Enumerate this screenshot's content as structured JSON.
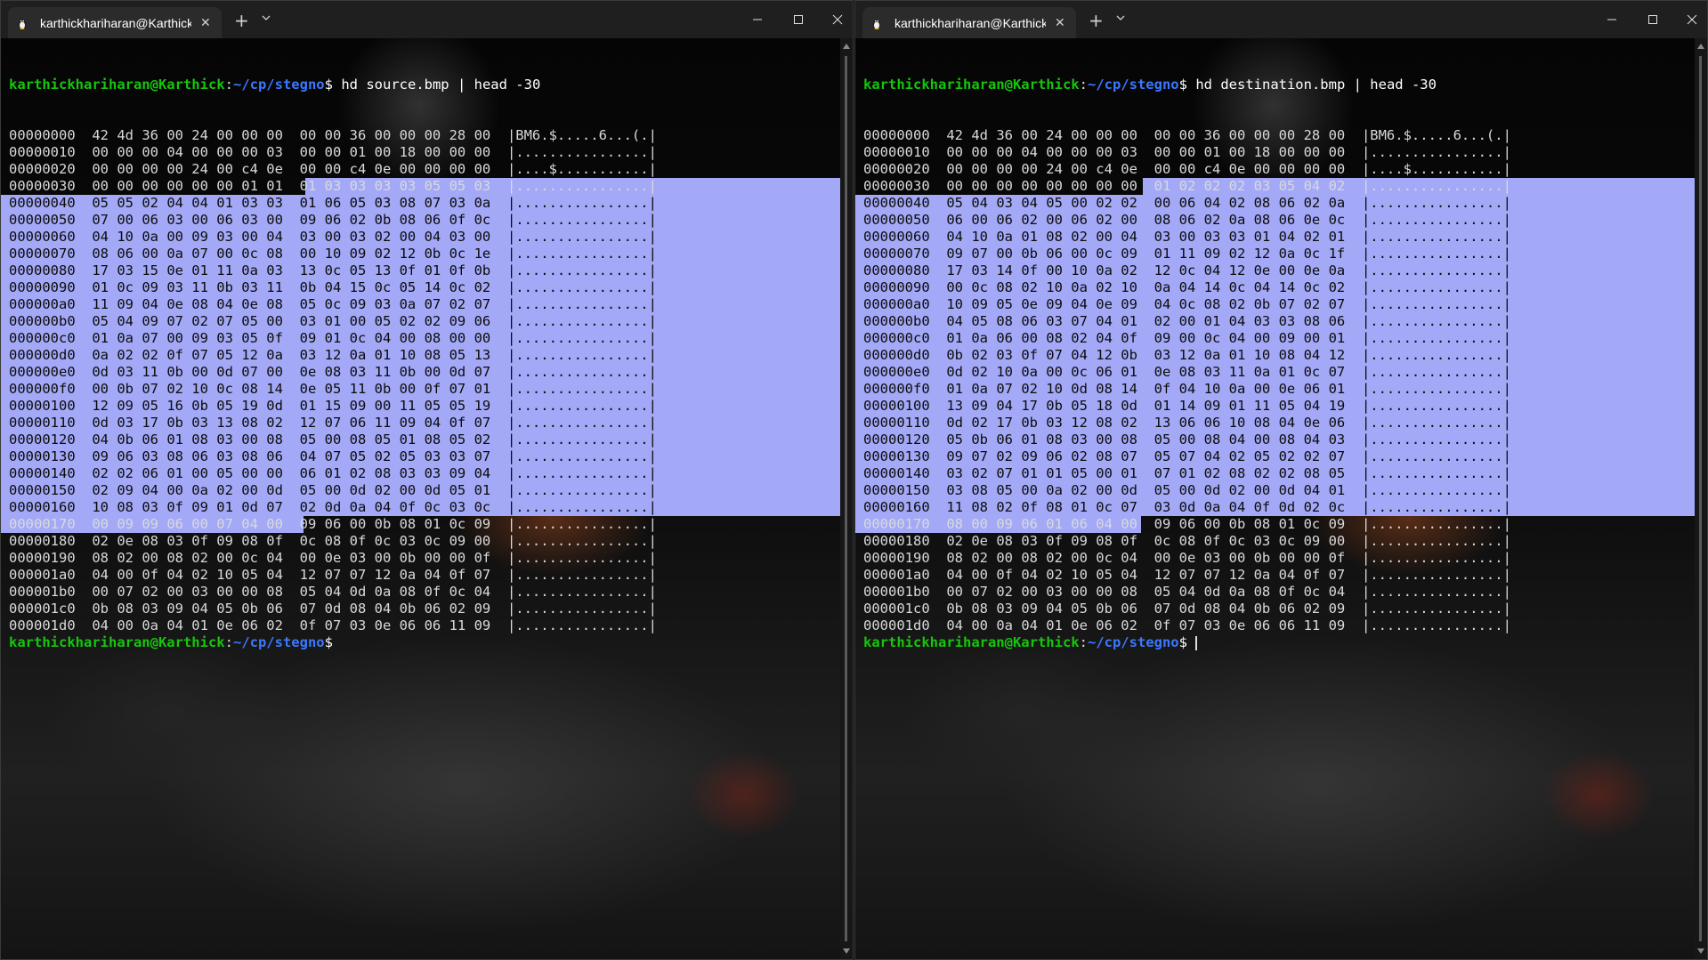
{
  "windows": [
    {
      "tab_title": "karthickhariharan@Karthick",
      "prompt_user": "karthickhariharan@Karthick",
      "prompt_path": "~/cp/stegno",
      "command": "hd source.bmp | head -30",
      "rows": [
        {
          "addr": "00000000",
          "hex": "42 4d 36 00 24 00 00 00  00 00 36 00 00 00 28 00",
          "ascii": "|BM6.$.....6...(.|"
        },
        {
          "addr": "00000010",
          "hex": "00 00 00 04 00 00 00 03  00 00 01 00 18 00 00 00",
          "ascii": "|................|"
        },
        {
          "addr": "00000020",
          "hex": "00 00 00 00 24 00 c4 0e  00 00 c4 0e 00 00 00 00",
          "ascii": "|....$...........|"
        },
        {
          "addr": "00000030",
          "hex": "00 00 00 00 00 00 01 01  01 03 03 03 03 05 05 03",
          "ascii": "|................|"
        },
        {
          "addr": "00000040",
          "hex": "05 05 02 04 04 01 03 03  01 06 05 03 08 07 03 0a",
          "ascii": "|................|"
        },
        {
          "addr": "00000050",
          "hex": "07 00 06 03 00 06 03 00  09 06 02 0b 08 06 0f 0c",
          "ascii": "|................|"
        },
        {
          "addr": "00000060",
          "hex": "04 10 0a 00 09 03 00 04  03 00 03 02 00 04 03 00",
          "ascii": "|................|"
        },
        {
          "addr": "00000070",
          "hex": "08 06 00 0a 07 00 0c 08  00 10 09 02 12 0b 0c 1e",
          "ascii": "|................|"
        },
        {
          "addr": "00000080",
          "hex": "17 03 15 0e 01 11 0a 03  13 0c 05 13 0f 01 0f 0b",
          "ascii": "|................|"
        },
        {
          "addr": "00000090",
          "hex": "01 0c 09 03 11 0b 03 11  0b 04 15 0c 05 14 0c 02",
          "ascii": "|................|"
        },
        {
          "addr": "000000a0",
          "hex": "11 09 04 0e 08 04 0e 08  05 0c 09 03 0a 07 02 07",
          "ascii": "|................|"
        },
        {
          "addr": "000000b0",
          "hex": "05 04 09 07 02 07 05 00  03 01 00 05 02 02 09 06",
          "ascii": "|................|"
        },
        {
          "addr": "000000c0",
          "hex": "01 0a 07 00 09 03 05 0f  09 01 0c 04 00 08 00 00",
          "ascii": "|................|"
        },
        {
          "addr": "000000d0",
          "hex": "0a 02 02 0f 07 05 12 0a  03 12 0a 01 10 08 05 13",
          "ascii": "|................|"
        },
        {
          "addr": "000000e0",
          "hex": "0d 03 11 0b 00 0d 07 00  0e 08 03 11 0b 00 0d 07",
          "ascii": "|................|"
        },
        {
          "addr": "000000f0",
          "hex": "00 0b 07 02 10 0c 08 14  0e 05 11 0b 00 0f 07 01",
          "ascii": "|................|"
        },
        {
          "addr": "00000100",
          "hex": "12 09 05 16 0b 05 19 0d  01 15 09 00 11 05 05 19",
          "ascii": "|................|"
        },
        {
          "addr": "00000110",
          "hex": "0d 03 17 0b 03 13 08 02  12 07 06 11 09 04 0f 07",
          "ascii": "|................|"
        },
        {
          "addr": "00000120",
          "hex": "04 0b 06 01 08 03 00 08  05 00 08 05 01 08 05 02",
          "ascii": "|................|"
        },
        {
          "addr": "00000130",
          "hex": "09 06 03 08 06 03 08 06  04 07 05 02 05 03 03 07",
          "ascii": "|................|"
        },
        {
          "addr": "00000140",
          "hex": "02 02 06 01 00 05 00 00  06 01 02 08 03 03 09 04",
          "ascii": "|................|"
        },
        {
          "addr": "00000150",
          "hex": "02 09 04 00 0a 02 00 0d  05 00 0d 02 00 0d 05 01",
          "ascii": "|................|"
        },
        {
          "addr": "00000160",
          "hex": "10 08 03 0f 09 01 0d 07  02 0d 0a 04 0f 0c 03 0c",
          "ascii": "|................|"
        },
        {
          "addr": "00000170",
          "hex": "00 09 09 06 00 07 04 00  09 06 00 0b 08 01 0c 09",
          "ascii": "|................|"
        },
        {
          "addr": "00000180",
          "hex": "02 0e 08 03 0f 09 08 0f  0c 08 0f 0c 03 0c 09 00",
          "ascii": "|................|"
        },
        {
          "addr": "00000190",
          "hex": "08 02 00 08 02 00 0c 04  00 0e 03 00 0b 00 00 0f",
          "ascii": "|................|"
        },
        {
          "addr": "000001a0",
          "hex": "04 00 0f 04 02 10 05 04  12 07 07 12 0a 04 0f 07",
          "ascii": "|................|"
        },
        {
          "addr": "000001b0",
          "hex": "00 07 02 00 03 00 00 08  05 04 0d 0a 08 0f 0c 04",
          "ascii": "|................|"
        },
        {
          "addr": "000001c0",
          "hex": "0b 08 03 09 04 05 0b 06  07 0d 08 04 0b 06 02 09",
          "ascii": "|................|"
        },
        {
          "addr": "000001d0",
          "hex": "04 00 0a 04 01 0e 06 02  0f 07 03 0e 06 06 11 09",
          "ascii": "|................|"
        }
      ]
    },
    {
      "tab_title": "karthickhariharan@Karthick",
      "prompt_user": "karthickhariharan@Karthick",
      "prompt_path": "~/cp/stegno",
      "command": "hd destination.bmp | head -30",
      "rows": [
        {
          "addr": "00000000",
          "hex": "42 4d 36 00 24 00 00 00  00 00 36 00 00 00 28 00",
          "ascii": "|BM6.$.....6...(.|"
        },
        {
          "addr": "00000010",
          "hex": "00 00 00 04 00 00 00 03  00 00 01 00 18 00 00 00",
          "ascii": "|................|"
        },
        {
          "addr": "00000020",
          "hex": "00 00 00 00 24 00 c4 0e  00 00 c4 0e 00 00 00 00",
          "ascii": "|....$...........|"
        },
        {
          "addr": "00000030",
          "hex": "00 00 00 00 00 00 00 00  01 02 02 02 03 05 04 02",
          "ascii": "|................|"
        },
        {
          "addr": "00000040",
          "hex": "05 04 03 04 05 00 02 02  00 06 04 02 08 06 02 0a",
          "ascii": "|................|"
        },
        {
          "addr": "00000050",
          "hex": "06 00 06 02 00 06 02 00  08 06 02 0a 08 06 0e 0c",
          "ascii": "|................|"
        },
        {
          "addr": "00000060",
          "hex": "04 10 0a 01 08 02 00 04  03 00 03 03 01 04 02 01",
          "ascii": "|................|"
        },
        {
          "addr": "00000070",
          "hex": "09 07 00 0b 06 00 0c 09  01 11 09 02 12 0a 0c 1f",
          "ascii": "|................|"
        },
        {
          "addr": "00000080",
          "hex": "17 03 14 0f 00 10 0a 02  12 0c 04 12 0e 00 0e 0a",
          "ascii": "|................|"
        },
        {
          "addr": "00000090",
          "hex": "00 0c 08 02 10 0a 02 10  0a 04 14 0c 04 14 0c 02",
          "ascii": "|................|"
        },
        {
          "addr": "000000a0",
          "hex": "10 09 05 0e 09 04 0e 09  04 0c 08 02 0b 07 02 07",
          "ascii": "|................|"
        },
        {
          "addr": "000000b0",
          "hex": "04 05 08 06 03 07 04 01  02 00 01 04 03 03 08 06",
          "ascii": "|................|"
        },
        {
          "addr": "000000c0",
          "hex": "01 0a 06 00 08 02 04 0f  09 00 0c 04 00 09 00 01",
          "ascii": "|................|"
        },
        {
          "addr": "000000d0",
          "hex": "0b 02 03 0f 07 04 12 0b  03 12 0a 01 10 08 04 12",
          "ascii": "|................|"
        },
        {
          "addr": "000000e0",
          "hex": "0d 02 10 0a 00 0c 06 01  0e 08 03 11 0a 01 0c 07",
          "ascii": "|................|"
        },
        {
          "addr": "000000f0",
          "hex": "01 0a 07 02 10 0d 08 14  0f 04 10 0a 00 0e 06 01",
          "ascii": "|................|"
        },
        {
          "addr": "00000100",
          "hex": "13 09 04 17 0b 05 18 0d  01 14 09 01 11 05 04 19",
          "ascii": "|................|"
        },
        {
          "addr": "00000110",
          "hex": "0d 02 17 0b 03 12 08 02  13 06 06 10 08 04 0e 06",
          "ascii": "|................|"
        },
        {
          "addr": "00000120",
          "hex": "05 0b 06 01 08 03 00 08  05 00 08 04 00 08 04 03",
          "ascii": "|................|"
        },
        {
          "addr": "00000130",
          "hex": "09 07 02 09 06 02 08 07  05 07 04 02 05 02 02 07",
          "ascii": "|................|"
        },
        {
          "addr": "00000140",
          "hex": "03 02 07 01 01 05 00 01  07 01 02 08 02 02 08 05",
          "ascii": "|................|"
        },
        {
          "addr": "00000150",
          "hex": "03 08 05 00 0a 02 00 0d  05 00 0d 02 00 0d 04 01",
          "ascii": "|................|"
        },
        {
          "addr": "00000160",
          "hex": "11 08 02 0f 08 01 0c 07  03 0d 0a 04 0f 0d 02 0c",
          "ascii": "|................|"
        },
        {
          "addr": "00000170",
          "hex": "08 00 09 06 01 06 04 00  09 06 00 0b 08 01 0c 09",
          "ascii": "|................|"
        },
        {
          "addr": "00000180",
          "hex": "02 0e 08 03 0f 09 08 0f  0c 08 0f 0c 03 0c 09 00",
          "ascii": "|................|"
        },
        {
          "addr": "00000190",
          "hex": "08 02 00 08 02 00 0c 04  00 0e 03 00 0b 00 00 0f",
          "ascii": "|................|"
        },
        {
          "addr": "000001a0",
          "hex": "04 00 0f 04 02 10 05 04  12 07 07 12 0a 04 0f 07",
          "ascii": "|................|"
        },
        {
          "addr": "000001b0",
          "hex": "00 07 02 00 03 00 00 08  05 04 0d 0a 08 0f 0c 04",
          "ascii": "|................|"
        },
        {
          "addr": "000001c0",
          "hex": "0b 08 03 09 04 05 0b 06  07 0d 08 04 0b 06 02 09",
          "ascii": "|................|"
        },
        {
          "addr": "000001d0",
          "hex": "04 00 0a 04 01 0e 06 02  0f 07 03 0e 06 06 11 09",
          "ascii": "|................|"
        }
      ]
    }
  ],
  "colors": {
    "prompt_user": "#16c60c",
    "prompt_path": "#3b78ff",
    "selection": "#a3a9f7",
    "text": "#d9d9d9"
  },
  "icons": {
    "tab_icon": "linux-penguin-icon",
    "tab_close": "close-icon",
    "new_tab": "plus-icon",
    "dropdown": "chevron-down-icon",
    "minimize": "minimize-icon",
    "maximize": "maximize-icon",
    "close_window": "close-icon"
  },
  "glyphs": {
    "tab_close": "✕",
    "new_tab": "+",
    "prompt_sign": "$"
  }
}
